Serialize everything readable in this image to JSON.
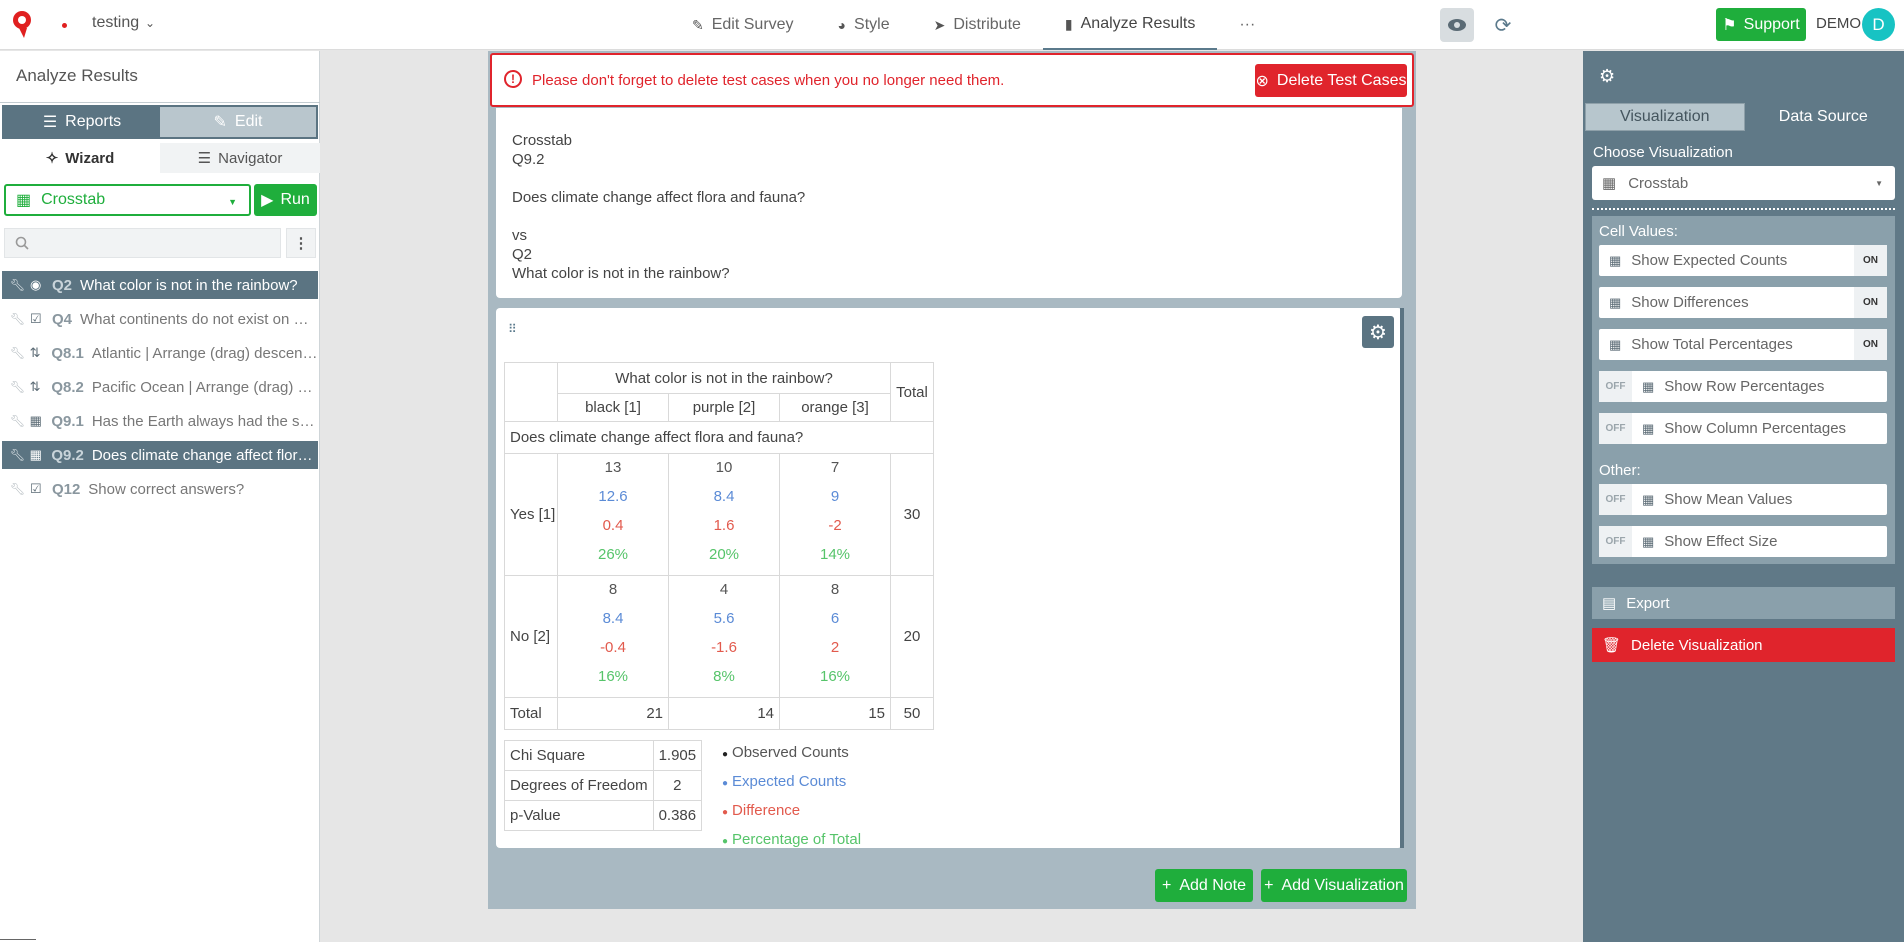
{
  "topbar": {
    "survey_name": "testing",
    "nav": [
      {
        "label": "Edit Survey",
        "icon": "edit-icon"
      },
      {
        "label": "Style",
        "icon": "palette-icon"
      },
      {
        "label": "Distribute",
        "icon": "send-icon"
      },
      {
        "label": "Analyze Results",
        "icon": "bar-chart-icon"
      }
    ],
    "more": "···",
    "support_label": "Support",
    "user_label": "DEMO",
    "avatar_letter": "D"
  },
  "left": {
    "title": "Analyze Results",
    "reports_label": "Reports",
    "edit_label": "Edit",
    "wizard_label": "Wizard",
    "navigator_label": "Navigator",
    "visualization": "Crosstab",
    "run_label": "Run",
    "search_placeholder": "",
    "questions": [
      {
        "num": "Q2",
        "label": "What color is not in the rainbow?",
        "selected": true
      },
      {
        "num": "Q4",
        "label": "What continents do not exist on Earth?",
        "selected": false
      },
      {
        "num": "Q8.1",
        "label": "Atlantic | Arrange (drag) descending",
        "selected": false
      },
      {
        "num": "Q8.2",
        "label": "Pacific Ocean | Arrange (drag) descending",
        "selected": false
      },
      {
        "num": "Q9.1",
        "label": "Has the Earth always had the same shape?",
        "selected": false
      },
      {
        "num": "Q9.2",
        "label": "Does climate change affect flora and fauna?",
        "selected": true
      },
      {
        "num": "Q12",
        "label": "Show correct answers?",
        "selected": false
      }
    ]
  },
  "alert": {
    "text": "Please don't forget to delete test cases when you no longer need them.",
    "button": "Delete Test Cases"
  },
  "description": {
    "type": "Crosstab",
    "q1_num": "Q9.2",
    "q1_text": "Does climate change affect flora and fauna?",
    "vs": "vs",
    "q2_num": "Q2",
    "q2_text": "What color is not in the rainbow?"
  },
  "crosstab": {
    "col_question": "What color is not in the rainbow?",
    "row_question": "Does climate change affect flora and fauna?",
    "total_label": "Total",
    "columns": [
      "black [1]",
      "purple [2]",
      "orange [3]"
    ],
    "rows": [
      {
        "label": "Yes [1]",
        "total": "30",
        "cells": [
          {
            "obs": "13",
            "exp": "12.6",
            "diff": "0.4",
            "pct": "26%"
          },
          {
            "obs": "10",
            "exp": "8.4",
            "diff": "1.6",
            "pct": "20%"
          },
          {
            "obs": "7",
            "exp": "9",
            "diff": "-2",
            "pct": "14%"
          }
        ]
      },
      {
        "label": "No [2]",
        "total": "20",
        "cells": [
          {
            "obs": "8",
            "exp": "8.4",
            "diff": "-0.4",
            "pct": "16%"
          },
          {
            "obs": "4",
            "exp": "5.6",
            "diff": "-1.6",
            "pct": "8%"
          },
          {
            "obs": "8",
            "exp": "6",
            "diff": "2",
            "pct": "16%"
          }
        ]
      }
    ],
    "col_totals": [
      "21",
      "14",
      "15"
    ],
    "grand_total": "50"
  },
  "stats": [
    {
      "label": "Chi Square",
      "value": "1.905"
    },
    {
      "label": "Degrees of Freedom",
      "value": "2"
    },
    {
      "label": "p-Value",
      "value": "0.386"
    }
  ],
  "legend": [
    {
      "label": "Observed Counts",
      "color": "#333333"
    },
    {
      "label": "Expected Counts",
      "color": "#5b8bd6"
    },
    {
      "label": "Difference",
      "color": "#e25a4d"
    },
    {
      "label": "Percentage of Total",
      "color": "#56c46a"
    }
  ],
  "actions": {
    "add_note": "Add Note",
    "add_visualization": "Add Visualization"
  },
  "right": {
    "tab_visualization": "Visualization",
    "tab_data_source": "Data Source",
    "choose_label": "Choose Visualization",
    "choose_value": "Crosstab",
    "cell_values_label": "Cell Values:",
    "other_label": "Other:",
    "options": [
      {
        "label": "Show Expected Counts",
        "state": "ON"
      },
      {
        "label": "Show Differences",
        "state": "ON"
      },
      {
        "label": "Show Total Percentages",
        "state": "ON"
      },
      {
        "label": "Show Row Percentages",
        "state": "OFF"
      },
      {
        "label": "Show Column Percentages",
        "state": "OFF"
      },
      {
        "label": "Show Mean Values",
        "state": "OFF"
      },
      {
        "label": "Show Effect Size",
        "state": "OFF"
      }
    ],
    "export_label": "Export",
    "delete_label": "Delete Visualization"
  },
  "colors": {
    "accent_green": "#1fae3c",
    "danger_red": "#e0242c",
    "panel_slate": "#607987"
  }
}
